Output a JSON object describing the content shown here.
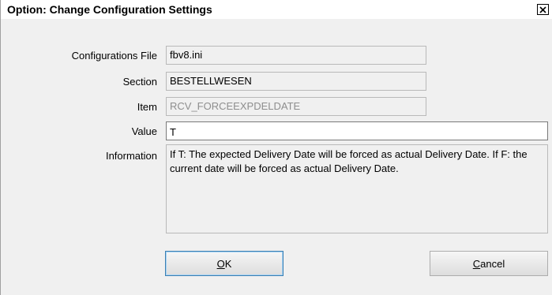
{
  "dialog": {
    "title": "Option: Change Configuration Settings",
    "close_glyph": "✕"
  },
  "form": {
    "config_file": {
      "label": "Configurations File",
      "value": "fbv8.ini"
    },
    "section": {
      "label": "Section",
      "value": "BESTELLWESEN"
    },
    "item": {
      "label": "Item",
      "value": "RCV_FORCEEXPDELDATE"
    },
    "value": {
      "label": "Value",
      "value": "T"
    },
    "information": {
      "label": "Information",
      "text": "If T: The expected Delivery Date will be forced as actual Delivery Date. If F: the current date will be forced as actual Delivery Date."
    }
  },
  "buttons": {
    "ok": {
      "mnemonic": "O",
      "rest": "K"
    },
    "cancel": {
      "mnemonic": "C",
      "rest": "ancel"
    }
  },
  "colors": {
    "dialog_bg": "#f0f0f0",
    "default_button_border": "#3c7fb1"
  }
}
